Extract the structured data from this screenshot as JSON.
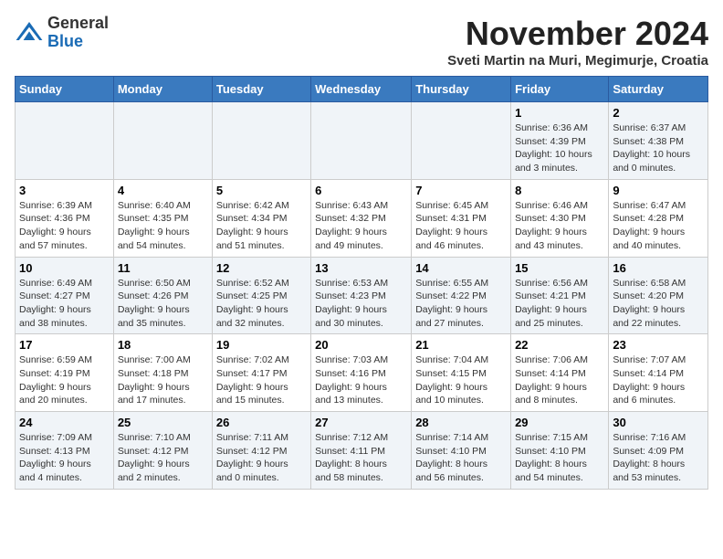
{
  "logo": {
    "line1": "General",
    "line2": "Blue"
  },
  "title": "November 2024",
  "location": "Sveti Martin na Muri, Megimurje, Croatia",
  "weekdays": [
    "Sunday",
    "Monday",
    "Tuesday",
    "Wednesday",
    "Thursday",
    "Friday",
    "Saturday"
  ],
  "weeks": [
    [
      {
        "day": "",
        "info": ""
      },
      {
        "day": "",
        "info": ""
      },
      {
        "day": "",
        "info": ""
      },
      {
        "day": "",
        "info": ""
      },
      {
        "day": "",
        "info": ""
      },
      {
        "day": "1",
        "info": "Sunrise: 6:36 AM\nSunset: 4:39 PM\nDaylight: 10 hours\nand 3 minutes."
      },
      {
        "day": "2",
        "info": "Sunrise: 6:37 AM\nSunset: 4:38 PM\nDaylight: 10 hours\nand 0 minutes."
      }
    ],
    [
      {
        "day": "3",
        "info": "Sunrise: 6:39 AM\nSunset: 4:36 PM\nDaylight: 9 hours\nand 57 minutes."
      },
      {
        "day": "4",
        "info": "Sunrise: 6:40 AM\nSunset: 4:35 PM\nDaylight: 9 hours\nand 54 minutes."
      },
      {
        "day": "5",
        "info": "Sunrise: 6:42 AM\nSunset: 4:34 PM\nDaylight: 9 hours\nand 51 minutes."
      },
      {
        "day": "6",
        "info": "Sunrise: 6:43 AM\nSunset: 4:32 PM\nDaylight: 9 hours\nand 49 minutes."
      },
      {
        "day": "7",
        "info": "Sunrise: 6:45 AM\nSunset: 4:31 PM\nDaylight: 9 hours\nand 46 minutes."
      },
      {
        "day": "8",
        "info": "Sunrise: 6:46 AM\nSunset: 4:30 PM\nDaylight: 9 hours\nand 43 minutes."
      },
      {
        "day": "9",
        "info": "Sunrise: 6:47 AM\nSunset: 4:28 PM\nDaylight: 9 hours\nand 40 minutes."
      }
    ],
    [
      {
        "day": "10",
        "info": "Sunrise: 6:49 AM\nSunset: 4:27 PM\nDaylight: 9 hours\nand 38 minutes."
      },
      {
        "day": "11",
        "info": "Sunrise: 6:50 AM\nSunset: 4:26 PM\nDaylight: 9 hours\nand 35 minutes."
      },
      {
        "day": "12",
        "info": "Sunrise: 6:52 AM\nSunset: 4:25 PM\nDaylight: 9 hours\nand 32 minutes."
      },
      {
        "day": "13",
        "info": "Sunrise: 6:53 AM\nSunset: 4:23 PM\nDaylight: 9 hours\nand 30 minutes."
      },
      {
        "day": "14",
        "info": "Sunrise: 6:55 AM\nSunset: 4:22 PM\nDaylight: 9 hours\nand 27 minutes."
      },
      {
        "day": "15",
        "info": "Sunrise: 6:56 AM\nSunset: 4:21 PM\nDaylight: 9 hours\nand 25 minutes."
      },
      {
        "day": "16",
        "info": "Sunrise: 6:58 AM\nSunset: 4:20 PM\nDaylight: 9 hours\nand 22 minutes."
      }
    ],
    [
      {
        "day": "17",
        "info": "Sunrise: 6:59 AM\nSunset: 4:19 PM\nDaylight: 9 hours\nand 20 minutes."
      },
      {
        "day": "18",
        "info": "Sunrise: 7:00 AM\nSunset: 4:18 PM\nDaylight: 9 hours\nand 17 minutes."
      },
      {
        "day": "19",
        "info": "Sunrise: 7:02 AM\nSunset: 4:17 PM\nDaylight: 9 hours\nand 15 minutes."
      },
      {
        "day": "20",
        "info": "Sunrise: 7:03 AM\nSunset: 4:16 PM\nDaylight: 9 hours\nand 13 minutes."
      },
      {
        "day": "21",
        "info": "Sunrise: 7:04 AM\nSunset: 4:15 PM\nDaylight: 9 hours\nand 10 minutes."
      },
      {
        "day": "22",
        "info": "Sunrise: 7:06 AM\nSunset: 4:14 PM\nDaylight: 9 hours\nand 8 minutes."
      },
      {
        "day": "23",
        "info": "Sunrise: 7:07 AM\nSunset: 4:14 PM\nDaylight: 9 hours\nand 6 minutes."
      }
    ],
    [
      {
        "day": "24",
        "info": "Sunrise: 7:09 AM\nSunset: 4:13 PM\nDaylight: 9 hours\nand 4 minutes."
      },
      {
        "day": "25",
        "info": "Sunrise: 7:10 AM\nSunset: 4:12 PM\nDaylight: 9 hours\nand 2 minutes."
      },
      {
        "day": "26",
        "info": "Sunrise: 7:11 AM\nSunset: 4:12 PM\nDaylight: 9 hours\nand 0 minutes."
      },
      {
        "day": "27",
        "info": "Sunrise: 7:12 AM\nSunset: 4:11 PM\nDaylight: 8 hours\nand 58 minutes."
      },
      {
        "day": "28",
        "info": "Sunrise: 7:14 AM\nSunset: 4:10 PM\nDaylight: 8 hours\nand 56 minutes."
      },
      {
        "day": "29",
        "info": "Sunrise: 7:15 AM\nSunset: 4:10 PM\nDaylight: 8 hours\nand 54 minutes."
      },
      {
        "day": "30",
        "info": "Sunrise: 7:16 AM\nSunset: 4:09 PM\nDaylight: 8 hours\nand 53 minutes."
      }
    ]
  ]
}
